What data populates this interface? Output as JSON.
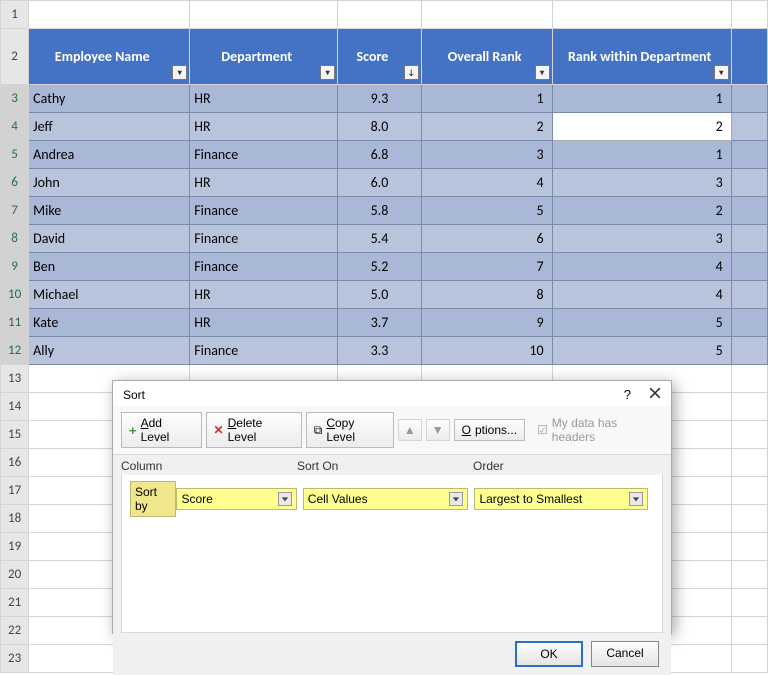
{
  "sheet": {
    "columns": [
      "Employee Name",
      "Department",
      "Score",
      "Overall Rank",
      "Rank within Department"
    ],
    "rows": [
      {
        "name": "Cathy",
        "dept": "HR",
        "score": "9.3",
        "overall": "1",
        "within": "1"
      },
      {
        "name": "Jeff",
        "dept": "HR",
        "score": "8.0",
        "overall": "2",
        "within": "2"
      },
      {
        "name": "Andrea",
        "dept": "Finance",
        "score": "6.8",
        "overall": "3",
        "within": "1"
      },
      {
        "name": "John",
        "dept": "HR",
        "score": "6.0",
        "overall": "4",
        "within": "3"
      },
      {
        "name": "Mike",
        "dept": "Finance",
        "score": "5.8",
        "overall": "5",
        "within": "2"
      },
      {
        "name": "David",
        "dept": "Finance",
        "score": "5.4",
        "overall": "6",
        "within": "3"
      },
      {
        "name": "Ben",
        "dept": "Finance",
        "score": "5.2",
        "overall": "7",
        "within": "4"
      },
      {
        "name": "Michael",
        "dept": "HR",
        "score": "5.0",
        "overall": "8",
        "within": "4"
      },
      {
        "name": "Kate",
        "dept": "HR",
        "score": "3.7",
        "overall": "9",
        "within": "5"
      },
      {
        "name": "Ally",
        "dept": "Finance",
        "score": "3.3",
        "overall": "10",
        "within": "5"
      }
    ],
    "row_numbers": [
      "1",
      "2",
      "3",
      "4",
      "5",
      "6",
      "7",
      "8",
      "9",
      "10",
      "11",
      "12",
      "13",
      "14",
      "15",
      "16",
      "17",
      "18",
      "19",
      "20",
      "21",
      "22",
      "23"
    ]
  },
  "dialog": {
    "title": "Sort",
    "help": "?",
    "toolbar": {
      "add": "Add Level",
      "delete": "Delete Level",
      "copy": "Copy Level",
      "options": "Options...",
      "headers": "My data has headers"
    },
    "headings": {
      "column": "Column",
      "sort_on": "Sort On",
      "order": "Order"
    },
    "row": {
      "label": "Sort by",
      "column": "Score",
      "sort_on": "Cell Values",
      "order": "Largest to Smallest"
    },
    "footer": {
      "ok": "OK",
      "cancel": "Cancel"
    }
  }
}
